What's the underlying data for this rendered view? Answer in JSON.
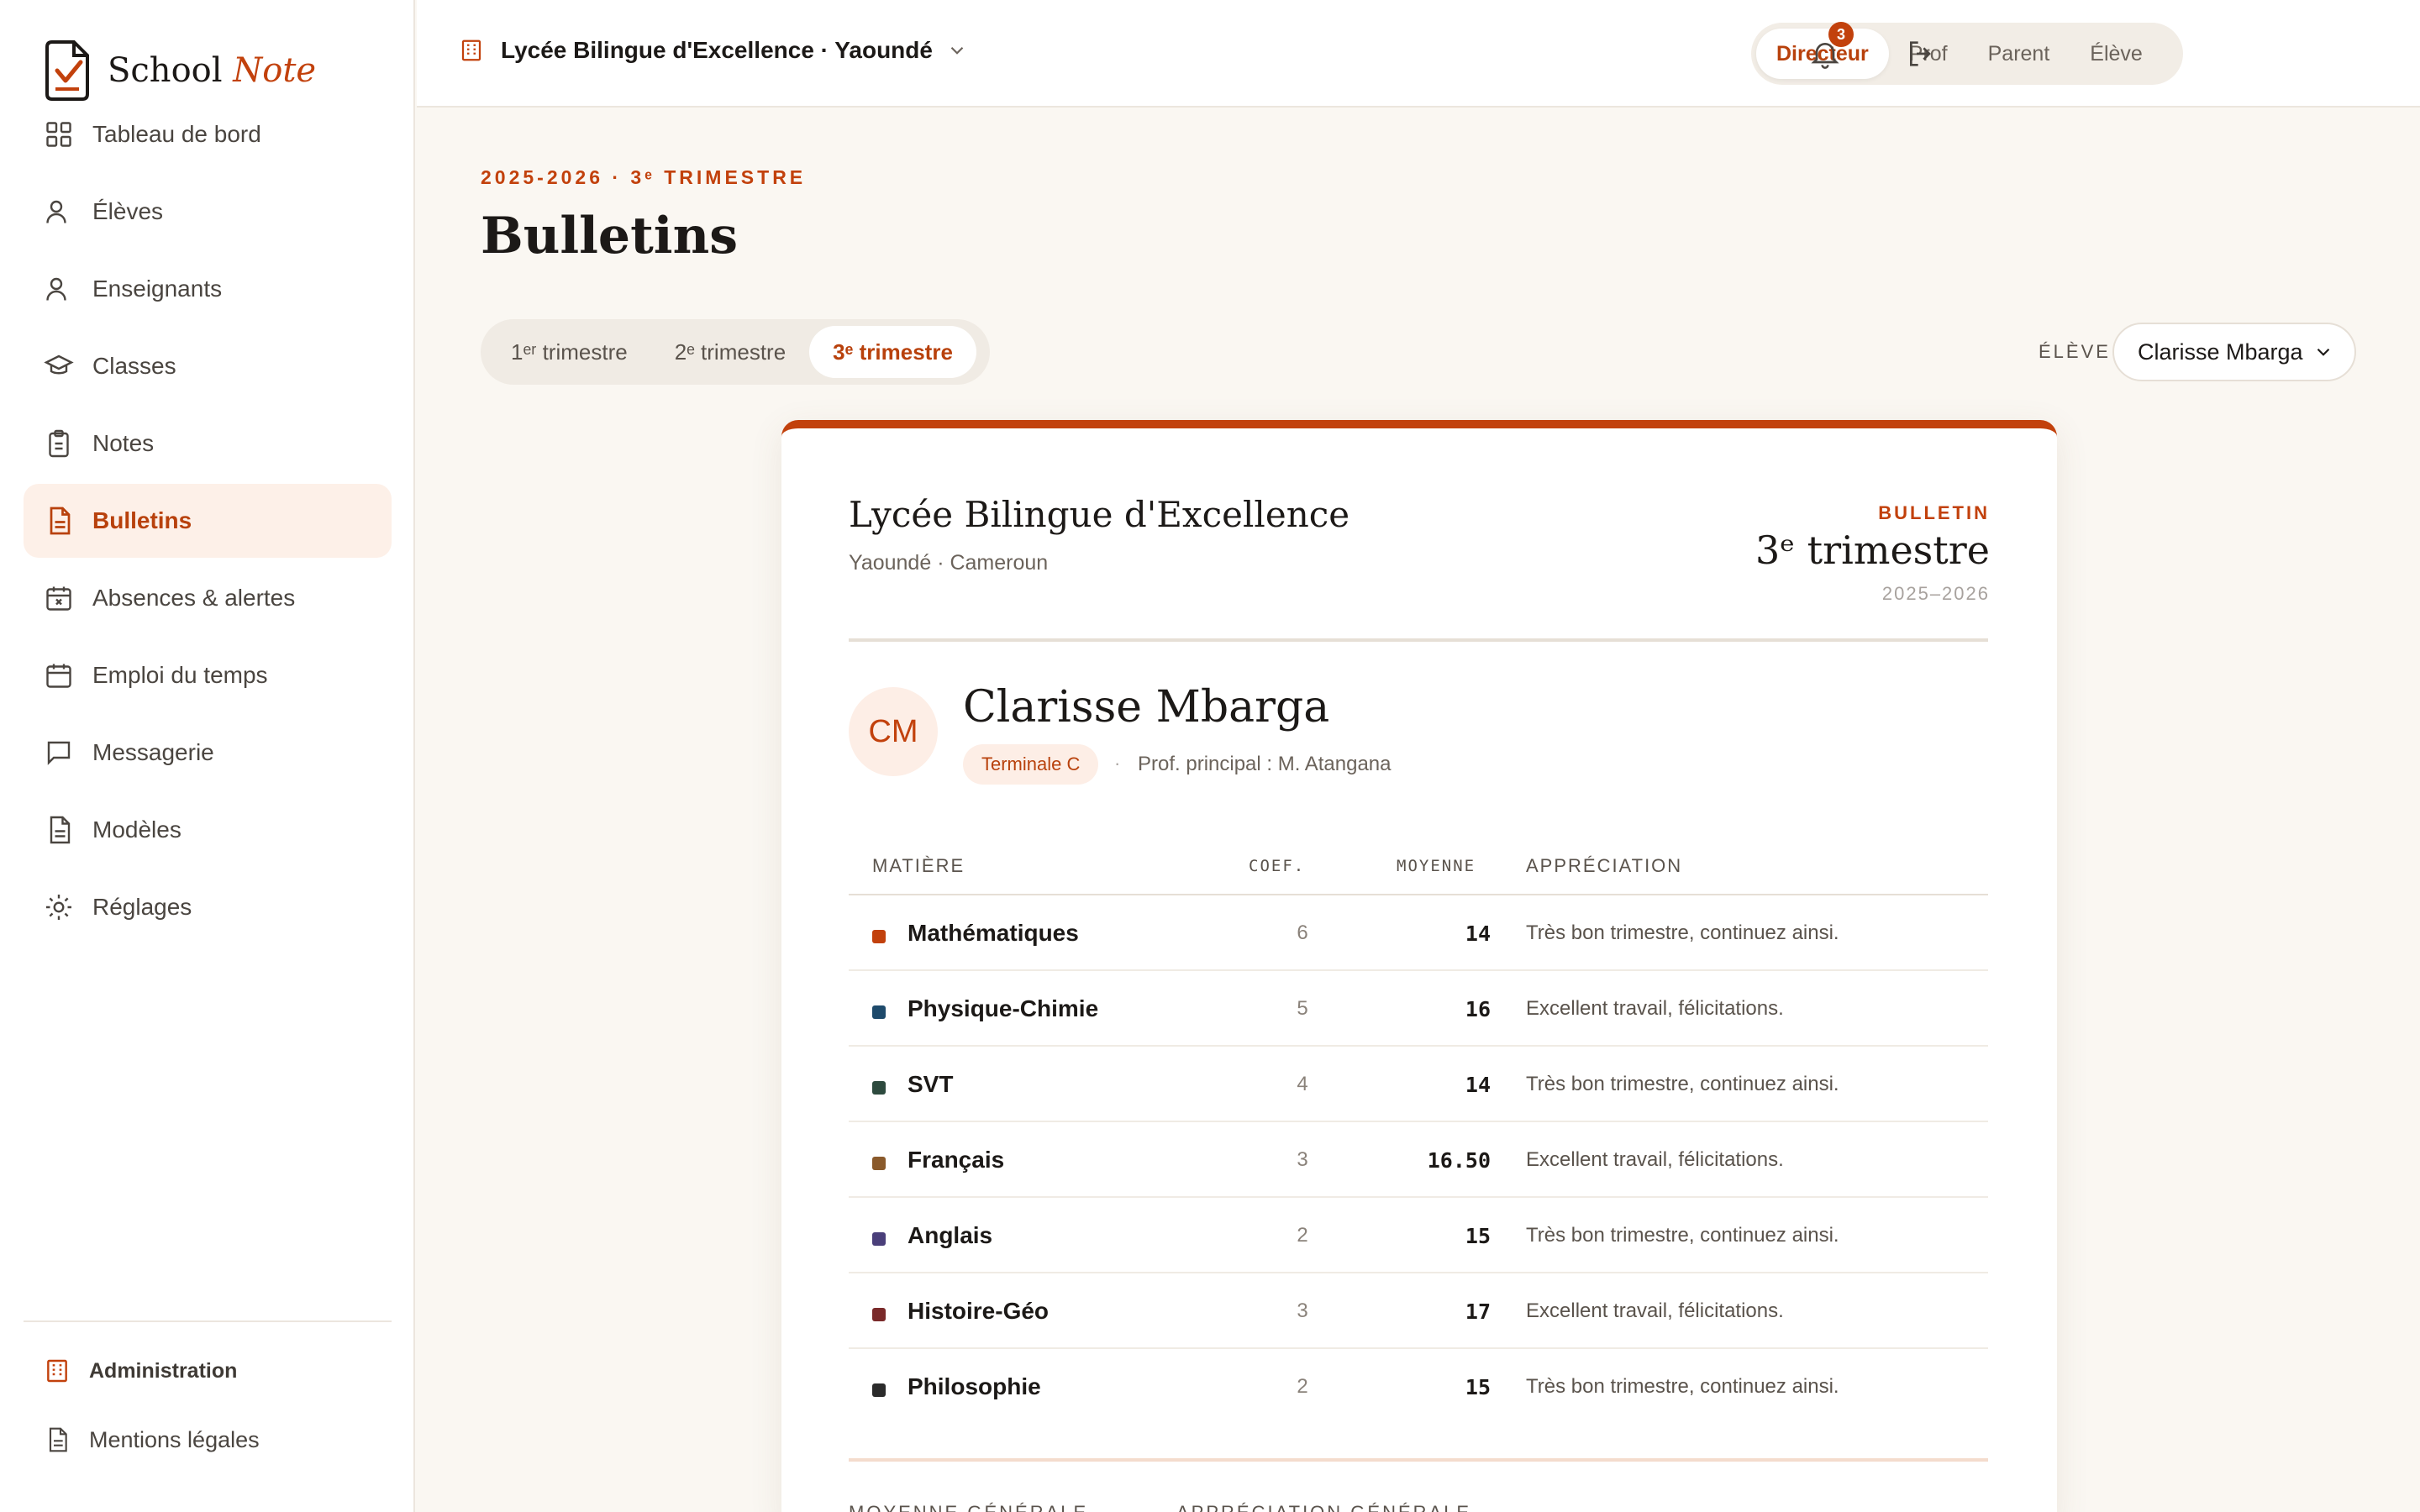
{
  "app": {
    "name_part1": "School",
    "name_part2": "Note"
  },
  "sidebar": {
    "items": [
      {
        "label": "Tableau de bord",
        "icon": "grid-icon",
        "active": false
      },
      {
        "label": "Élèves",
        "icon": "user-icon",
        "active": false
      },
      {
        "label": "Enseignants",
        "icon": "user-icon",
        "active": false
      },
      {
        "label": "Classes",
        "icon": "graduation-cap-icon",
        "active": false
      },
      {
        "label": "Notes",
        "icon": "clipboard-icon",
        "active": false
      },
      {
        "label": "Bulletins",
        "icon": "document-icon",
        "active": true
      },
      {
        "label": "Absences & alertes",
        "icon": "calendar-x-icon",
        "active": false
      },
      {
        "label": "Emploi du temps",
        "icon": "calendar-icon",
        "active": false
      },
      {
        "label": "Messagerie",
        "icon": "message-icon",
        "active": false
      },
      {
        "label": "Modèles",
        "icon": "document-icon",
        "active": false
      },
      {
        "label": "Réglages",
        "icon": "sun-gear-icon",
        "active": false
      }
    ],
    "footer": {
      "admin": "Administration",
      "legal": "Mentions légales"
    }
  },
  "topbar": {
    "school": "Lycée Bilingue d'Excellence · Yaoundé",
    "roles": [
      "Directeur",
      "Prof",
      "Parent",
      "Élève"
    ],
    "active_role": "Directeur",
    "notifications": "3"
  },
  "page": {
    "eyebrow": "2025-2026 · 3ᵉ TRIMESTRE",
    "title": "Bulletins",
    "terms": [
      "1ᵉʳ trimestre",
      "2ᵉ trimestre",
      "3ᵉ trimestre"
    ],
    "active_term": "3ᵉ trimestre",
    "student_label": "ÉLÈVE",
    "student_value": "Clarisse Mbarga"
  },
  "card": {
    "school": "Lycée Bilingue d'Excellence",
    "city": "Yaoundé · Cameroun",
    "kicker": "BULLETIN",
    "term": "3ᵉ trimestre",
    "year": "2025–2026",
    "initials": "CM",
    "student": "Clarisse Mbarga",
    "class": "Terminale C",
    "separator": "·",
    "prof": "Prof. principal : M. Atangana",
    "columns": {
      "subject": "MATIÈRE",
      "coef": "COEF.",
      "avg": "MOYENNE",
      "appr": "APPRÉCIATION"
    },
    "rows": [
      {
        "subject": "Mathématiques",
        "coef": "6",
        "avg": "14",
        "appr": "Très bon trimestre, continuez ainsi.",
        "color": "#c2410c"
      },
      {
        "subject": "Physique-Chimie",
        "coef": "5",
        "avg": "16",
        "appr": "Excellent travail, félicitations.",
        "color": "#1e4a6b"
      },
      {
        "subject": "SVT",
        "coef": "4",
        "avg": "14",
        "appr": "Très bon trimestre, continuez ainsi.",
        "color": "#2d4a3e"
      },
      {
        "subject": "Français",
        "coef": "3",
        "avg": "16.50",
        "appr": "Excellent travail, félicitations.",
        "color": "#8a5a2b"
      },
      {
        "subject": "Anglais",
        "coef": "2",
        "avg": "15",
        "appr": "Très bon trimestre, continuez ainsi.",
        "color": "#4a3f7a"
      },
      {
        "subject": "Histoire-Géo",
        "coef": "3",
        "avg": "17",
        "appr": "Excellent travail, félicitations.",
        "color": "#7a2a2a"
      },
      {
        "subject": "Philosophie",
        "coef": "2",
        "avg": "15",
        "appr": "Très bon trimestre, continuez ainsi.",
        "color": "#2b2b2b"
      }
    ],
    "summary": {
      "general_avg_label": "MOYENNE GÉNÉRALE",
      "general_appr_label": "APPRÉCIATION GÉNÉRALE"
    }
  },
  "colors": {
    "accent": "#c2410c",
    "background": "#faf7f2",
    "active_nav_bg": "#fdf0e8"
  }
}
